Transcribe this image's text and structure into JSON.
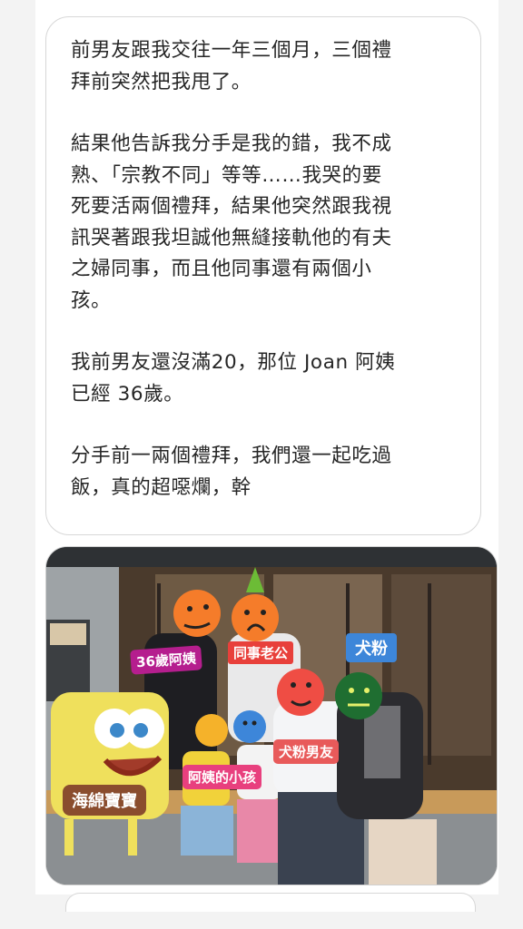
{
  "post": {
    "paragraphs": [
      "前男友跟我交往一年三個月，三個禮\n拜前突然把我甩了。",
      "結果他告訴我分手是我的錯，我不成\n熟、「宗教不同」等等……我哭的要\n死要活兩個禮拜，結果他突然跟我視\n訊哭著跟我坦誠他無縫接軌他的有夫\n之婦同事，而且他同事還有兩個小\n孩。",
      "我前男友還沒滿20，那位 Joan 阿姨\n已經 36歲。",
      "分手前一兩個禮拜，我們還一起吃過\n飯，真的超噁爛，幹"
    ]
  },
  "photo": {
    "labels": {
      "auntie": "36歲阿姨",
      "coworker_husband": "同事老公",
      "dog_fan": "犬粉",
      "dog_fan_boyfriend": "犬粉男友",
      "auntie_kids": "阿姨的小孩",
      "spongebob": "海綿寶寶"
    },
    "colors": {
      "auntie": "#b51e8e",
      "coworker_husband": "#e8403b",
      "dog_fan": "#3d86d9",
      "dog_fan_boyfriend": "#e85a5a",
      "auntie_kids": "#e8407e",
      "spongebob": "#8a4d2e"
    }
  }
}
